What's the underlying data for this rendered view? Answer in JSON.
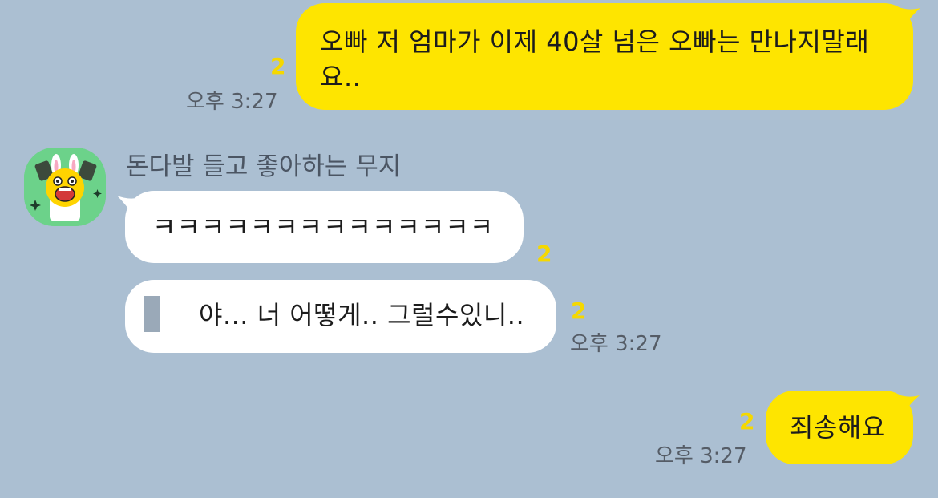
{
  "messages": [
    {
      "side": "me",
      "text_line1": "오빠 저 엄마가 이제 40살 넘은 오빠는 만나지말래",
      "text_line2": "요..",
      "unread": "2",
      "time": "오후 3:27"
    },
    {
      "side": "them",
      "sender": "돈다발 들고 좋아하는 무지",
      "text": "ㅋㅋㅋㅋㅋㅋㅋㅋㅋㅋㅋㅋㅋㅋ",
      "unread": "2"
    },
    {
      "side": "them",
      "text": "야... 너 어떻게.. 그럴수있니..",
      "unread": "2",
      "time": "오후 3:27"
    },
    {
      "side": "me",
      "text": "죄송해요",
      "unread": "2",
      "time": "오후 3:27"
    }
  ],
  "colors": {
    "background": "#abbfd2",
    "my_bubble": "#fee500",
    "their_bubble": "#ffffff",
    "unread": "#f5d800",
    "avatar_bg": "#6cd28a"
  },
  "icons": {
    "avatar": "muzi-holding-money-icon"
  }
}
